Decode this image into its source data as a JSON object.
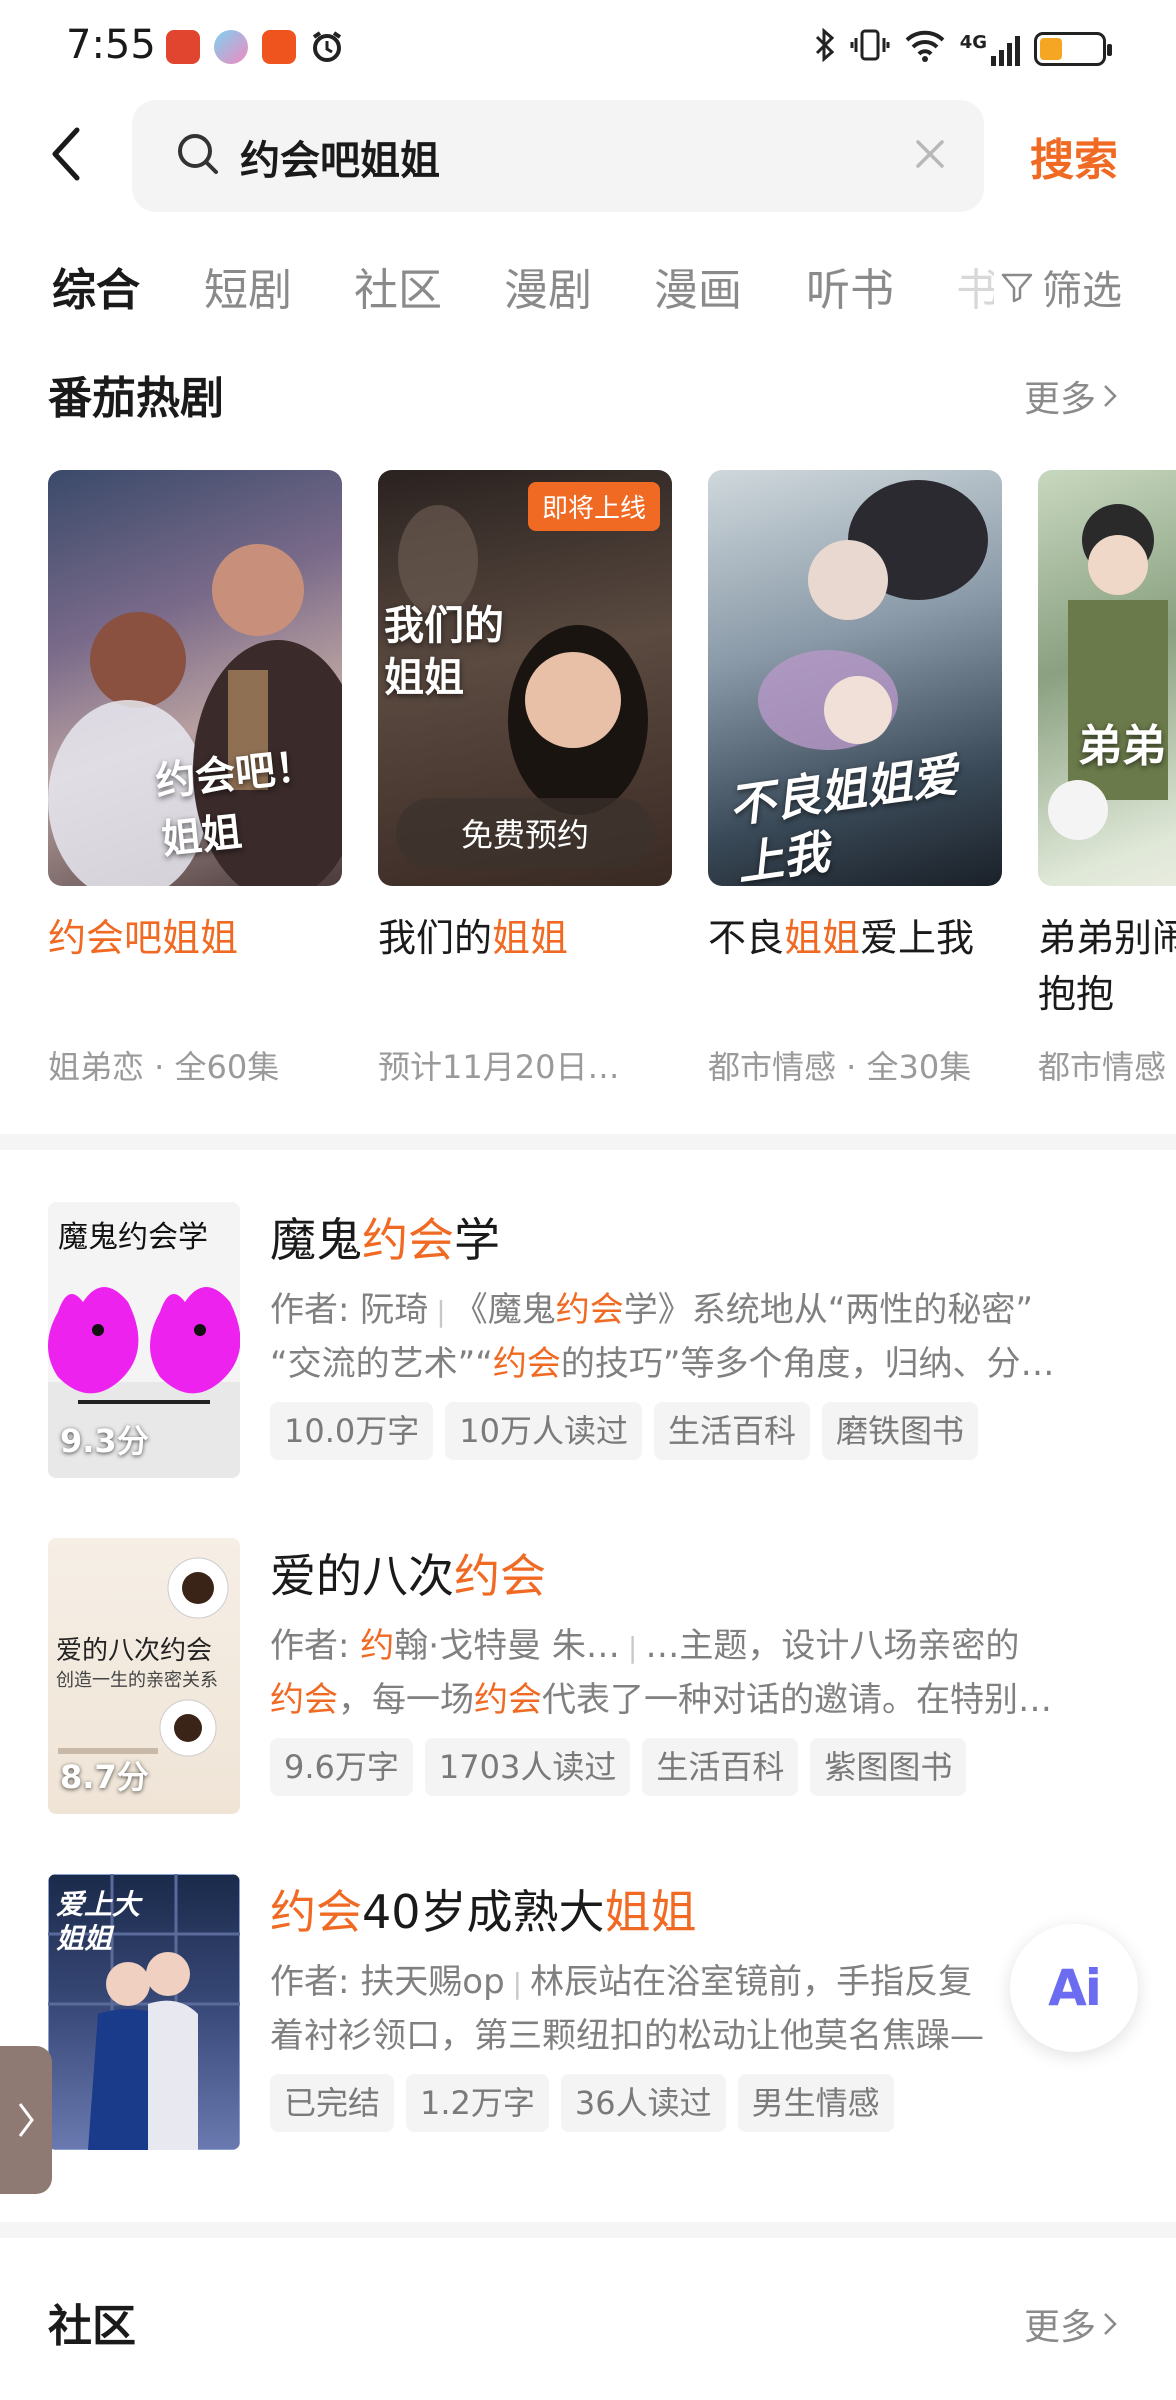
{
  "status_bar": {
    "time": "7:55",
    "network": "4G"
  },
  "search": {
    "query": "约会吧姐姐",
    "button_label": "搜索"
  },
  "tabs": [
    "综合",
    "短剧",
    "社区",
    "漫剧",
    "漫画",
    "听书",
    "书"
  ],
  "filter_label": "筛选",
  "hot_drama": {
    "title": "番茄热剧",
    "more": "更多",
    "cards": [
      {
        "title_parts": [
          "约会吧姐姐"
        ],
        "poster_text": "约会吧！姐姐",
        "meta": "姐弟恋 · 全60集"
      },
      {
        "title_parts": [
          "我们的",
          "姐姐"
        ],
        "poster_text": "我们的姐姐",
        "badge": "即将上线",
        "action": "免费预约",
        "meta": "预计11月20日…"
      },
      {
        "title_parts": [
          "不良",
          "姐姐",
          "爱上我"
        ],
        "poster_text": "不良姐姐爱上我",
        "meta": "都市情感 · 全30集"
      },
      {
        "title_line1": "弟弟别闹",
        "title_line2": "抱抱",
        "poster_text": "弟弟",
        "meta": "都市情感"
      }
    ]
  },
  "books": [
    {
      "title_parts": [
        "魔鬼",
        "约会",
        "学"
      ],
      "cover_title": "魔鬼约会学",
      "score": "9.3分",
      "author_label": "作者:",
      "author": "阮琦",
      "desc_line1_parts": [
        "《魔鬼",
        "约会",
        "学》系统地从“两性的秘密”"
      ],
      "desc_line2_parts": [
        "“交流的艺术”“",
        "约会",
        "的技巧”等多个角度，归纳、分…"
      ],
      "tags": [
        "10.0万字",
        "10万人读过",
        "生活百科",
        "磨铁图书"
      ]
    },
    {
      "title_parts": [
        "爱的八次",
        "约会"
      ],
      "cover_title": "爱的八次约会",
      "cover_subtitle": "创造一生的亲密关系",
      "score": "8.7分",
      "author_label": "作者:",
      "author_parts": [
        "约",
        "翰·戈特曼 朱…"
      ],
      "desc_line1": "…主题，设计八场亲密的",
      "desc_line2_parts": [
        "约会",
        "，每一场",
        "约会",
        "代表了一种对话的邀请。在特别…"
      ],
      "tags": [
        "9.6万字",
        "1703人读过",
        "生活百科",
        "紫图图书"
      ]
    },
    {
      "title_parts": [
        "约会",
        "40岁成熟大",
        "姐姐"
      ],
      "cover_title": "爱上大姐姐",
      "author_label": "作者:",
      "author": "扶天赐op",
      "desc_line1": "林辰站在浴室镜前，手指反复",
      "desc_line2": "着衬衫领口，第三颗纽扣的松动让他莫名焦躁—",
      "tags": [
        "已完结",
        "1.2万字",
        "36人读过",
        "男生情感"
      ]
    }
  ],
  "community": {
    "title": "社区",
    "more": "更多"
  },
  "ai_button": "Ai",
  "colors": {
    "accent": "#f06a23",
    "muted": "#8a8a8a",
    "tag_bg": "#f4f4f4"
  }
}
